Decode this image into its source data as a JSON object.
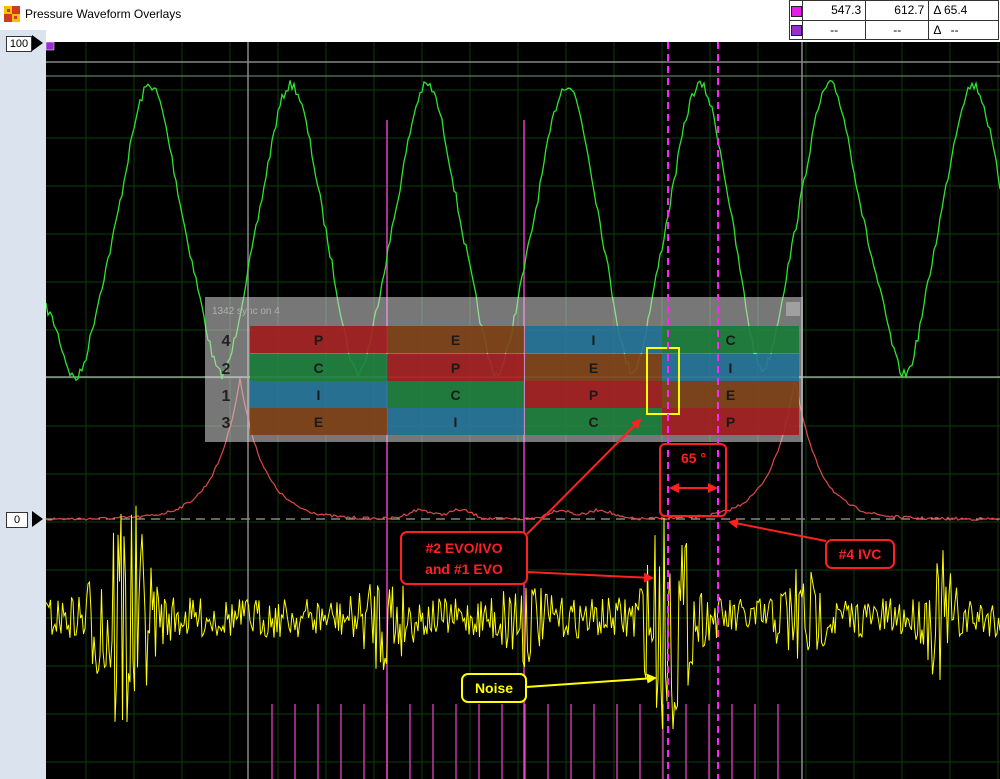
{
  "window": {
    "title": "Pressure Waveform Overlays",
    "app_icon": "checker-grid-icon"
  },
  "cursor_readout": {
    "rows": [
      {
        "color": "#e81ce8",
        "a": "547.3",
        "b": "612.7",
        "delta": "Δ 65.4"
      },
      {
        "color": "#9a2cd6",
        "a": "--",
        "b": "--",
        "delta": "Δ   --"
      }
    ]
  },
  "y_axis": {
    "top_label": "100",
    "zero_label": "0"
  },
  "sync_panel": {
    "header": "1342 sync on 4",
    "rows": [
      {
        "cyl": "4",
        "cells": [
          "P",
          "E",
          "I",
          "C"
        ]
      },
      {
        "cyl": "2",
        "cells": [
          "C",
          "P",
          "E",
          "I"
        ]
      },
      {
        "cyl": "1",
        "cells": [
          "I",
          "C",
          "P",
          "E"
        ]
      },
      {
        "cyl": "3",
        "cells": [
          "E",
          "I",
          "C",
          "P"
        ]
      }
    ],
    "stroke_colors": {
      "P": "#a11414",
      "E": "#7a3a0c",
      "I": "#1a6f96",
      "C": "#127a33"
    }
  },
  "annotations": {
    "angle": "65 °",
    "evo_line1": "#2 EVO/IVO",
    "evo_line2": "and #1 EVO",
    "ivc": "#4 IVC",
    "noise": "Noise"
  },
  "colors": {
    "pressure_trace": "#2ee52e",
    "vacuum_trace": "#e04848",
    "noise_trace": "#ffff00",
    "cursor": "#ff22ff",
    "plot_bg": "#000000",
    "grid": "#0d3a0d"
  }
}
